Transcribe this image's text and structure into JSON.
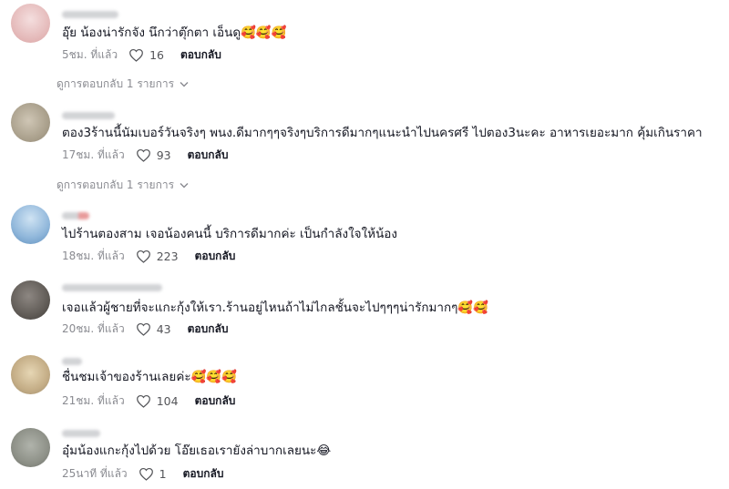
{
  "comments": [
    {
      "text": "อุ๊ย น้องน่ารักจัง นึกว่าตุ๊กตา เอ็นดู🥰🥰🥰",
      "time": "5ชม. ที่แล้ว",
      "likes": "16",
      "reply_label": "ตอบกลับ",
      "avatar_color": "#e9c9c9",
      "view_replies": "ดูการตอบกลับ 1 รายการ"
    },
    {
      "text": "ตอง3ร้านนี้นัมเบอร์วันจริงๆ พนง.ดีมากๆๆจริงๆบริการดีมากๆแนะนำไปนครศรี ไปตอง3นะคะ อาหารเยอะมาก คุ้มเกินราคา",
      "time": "17ชม. ที่แล้ว",
      "likes": "93",
      "reply_label": "ตอบกลับ",
      "avatar_color": "#b9ae9c",
      "view_replies": "ดูการตอบกลับ 1 รายการ"
    },
    {
      "text": "ไปร้านตองสาม เจอน้องคนนี้ บริการดีมากค่ะ เป็นกำลังใจให้น้อง",
      "time": "18ชม. ที่แล้ว",
      "likes": "223",
      "reply_label": "ตอบกลับ",
      "avatar_color": "#7fa9cf"
    },
    {
      "text": "เจอแล้วผู้ชายที่จะแกะกุ้งให้เรา.ร้านอยู่ไหนถ้าไม่ไกลชั้นจะไปๆๆๆน่ารักมากๆ🥰🥰",
      "time": "20ชม. ที่แล้ว",
      "likes": "43",
      "reply_label": "ตอบกลับ",
      "avatar_color": "#6e6a66"
    },
    {
      "text": "ชื่นชมเจ้าของร้านเลยค่ะ🥰🥰🥰",
      "time": "21ชม. ที่แล้ว",
      "likes": "104",
      "reply_label": "ตอบกลับ",
      "avatar_color": "#c9b89a"
    },
    {
      "text": "อุ๋มน้องแกะกุ้งไปด้วย โอ๊ยเธอเรายังล่าบากเลยนะ😂",
      "time": "25นาที ที่แล้ว",
      "likes": "1",
      "reply_label": "ตอบกลับ",
      "avatar_color": "#8e9188"
    }
  ]
}
